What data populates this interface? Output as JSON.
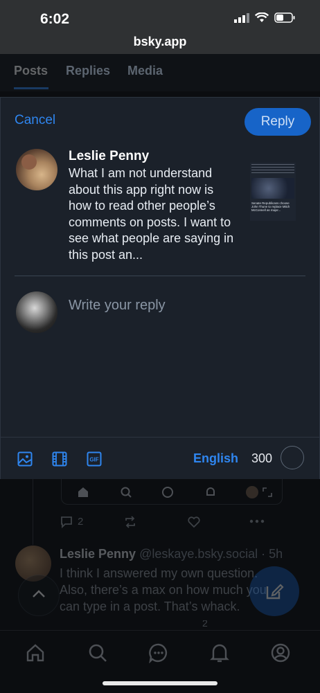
{
  "status": {
    "time": "6:02",
    "url": "bsky.app"
  },
  "profile_tabs": [
    "Posts",
    "Replies",
    "Media"
  ],
  "composer": {
    "cancel_label": "Cancel",
    "reply_label": "Reply",
    "quoted_post": {
      "author": "Leslie Penny",
      "text": "What I am not understand about this app right now is how to read other people’s comments on posts.  I want to see what people are saying in this post an...",
      "thumbnail_caption": "Senate Republicans choose John Thune to replace Mitch McConnell as major..."
    },
    "reply_placeholder": "Write your reply",
    "language": "English",
    "char_remaining": "300",
    "tool_icons": [
      "image-icon",
      "video-icon",
      "gif-icon"
    ]
  },
  "feed": {
    "post_reply_count": "2",
    "post_author": "Leslie Penny",
    "post_handle": "@leskaye.bsky.social",
    "post_age": "5h",
    "post_text": "I think I answered my own question. Also, there’s a max on how much you can type in a post. That’s  whack.",
    "next_reply_count": "2"
  },
  "bottom_nav": [
    "home-icon",
    "search-icon",
    "chat-icon",
    "bell-icon",
    "profile-icon"
  ],
  "colors": {
    "accent": "#2f86f0",
    "modal_bg": "#1b212a",
    "reply_button": "#1764c8"
  }
}
